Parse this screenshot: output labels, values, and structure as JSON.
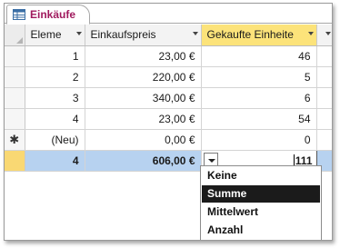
{
  "tab": {
    "label": "Einkäufe",
    "icon": "table-icon"
  },
  "columns": [
    {
      "label": "Eleme"
    },
    {
      "label": "Einkaufspreis"
    },
    {
      "label": "Gekaufte Einheite"
    }
  ],
  "rows": [
    {
      "selector": "",
      "id": "1",
      "price": "23,00 €",
      "units": "46"
    },
    {
      "selector": "",
      "id": "2",
      "price": "220,00 €",
      "units": "5"
    },
    {
      "selector": "",
      "id": "3",
      "price": "340,00 €",
      "units": "6"
    },
    {
      "selector": "",
      "id": "4",
      "price": "23,00 €",
      "units": "54"
    }
  ],
  "new_row": {
    "selector": "✱",
    "id": "(Neu)",
    "price": "0,00 €",
    "units": "0"
  },
  "total_row": {
    "id": "4",
    "price": "606,00 €",
    "units": "111"
  },
  "aggregate_menu": {
    "options": [
      "Keine",
      "Summe",
      "Mittelwert",
      "Anzahl"
    ],
    "selected": "Summe"
  },
  "colors": {
    "tab_text": "#a0195d",
    "active_header": "#fce37a",
    "total_row": "#b7d2f0",
    "menu_highlight": "#1b1b1b"
  }
}
